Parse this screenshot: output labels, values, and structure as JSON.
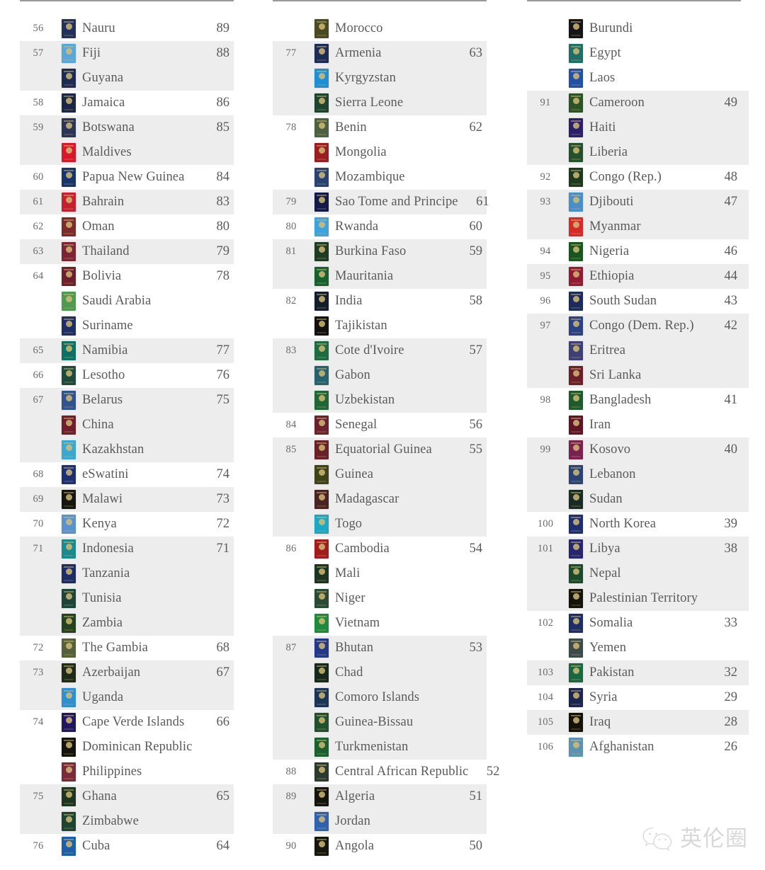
{
  "watermark": {
    "text": "英伦圈",
    "logo_icon": "wechat-logo-icon"
  },
  "columns": [
    {
      "id": "column-1",
      "rows": [
        {
          "rank": "56",
          "country": "Nauru",
          "score": "89",
          "shaded": false,
          "flag": "#22305a"
        },
        {
          "rank": "57",
          "country": "Fiji",
          "score": "88",
          "shaded": true,
          "flag": "#5aa7d8"
        },
        {
          "rank": "",
          "country": "Guyana",
          "score": "",
          "shaded": true,
          "flag": "#1d2a52"
        },
        {
          "rank": "58",
          "country": "Jamaica",
          "score": "86",
          "shaded": false,
          "flag": "#1b2545"
        },
        {
          "rank": "59",
          "country": "Botswana",
          "score": "85",
          "shaded": true,
          "flag": "#2c3554"
        },
        {
          "rank": "",
          "country": "Maldives",
          "score": "",
          "shaded": true,
          "flag": "#d8182a"
        },
        {
          "rank": "60",
          "country": "Papua New Guinea",
          "score": "84",
          "shaded": false,
          "flag": "#17356b"
        },
        {
          "rank": "61",
          "country": "Bahrain",
          "score": "83",
          "shaded": true,
          "flag": "#c42030"
        },
        {
          "rank": "62",
          "country": "Oman",
          "score": "80",
          "shaded": false,
          "flag": "#7c2b2b"
        },
        {
          "rank": "63",
          "country": "Thailand",
          "score": "79",
          "shaded": true,
          "flag": "#7d2435"
        },
        {
          "rank": "64",
          "country": "Bolivia",
          "score": "78",
          "shaded": false,
          "flag": "#6d1f2b"
        },
        {
          "rank": "",
          "country": "Saudi Arabia",
          "score": "",
          "shaded": false,
          "flag": "#4f9a52"
        },
        {
          "rank": "",
          "country": "Suriname",
          "score": "",
          "shaded": false,
          "flag": "#1d2f63"
        },
        {
          "rank": "65",
          "country": "Namibia",
          "score": "77",
          "shaded": true,
          "flag": "#0e6f63"
        },
        {
          "rank": "66",
          "country": "Lesotho",
          "score": "76",
          "shaded": false,
          "flag": "#1e4a3c"
        },
        {
          "rank": "67",
          "country": "Belarus",
          "score": "75",
          "shaded": true,
          "flag": "#2f538f"
        },
        {
          "rank": "",
          "country": "China",
          "score": "",
          "shaded": true,
          "flag": "#6f1f2c"
        },
        {
          "rank": "",
          "country": "Kazakhstan",
          "score": "",
          "shaded": true,
          "flag": "#3aa8d0"
        },
        {
          "rank": "68",
          "country": "eSwatini",
          "score": "74",
          "shaded": false,
          "flag": "#1c2f72"
        },
        {
          "rank": "69",
          "country": "Malawi",
          "score": "73",
          "shaded": true,
          "flag": "#171510"
        },
        {
          "rank": "70",
          "country": "Kenya",
          "score": "72",
          "shaded": false,
          "flag": "#5a92ce"
        },
        {
          "rank": "71",
          "country": "Indonesia",
          "score": "71",
          "shaded": true,
          "flag": "#1a8a8f"
        },
        {
          "rank": "",
          "country": "Tanzania",
          "score": "",
          "shaded": true,
          "flag": "#1e2c66"
        },
        {
          "rank": "",
          "country": "Tunisia",
          "score": "",
          "shaded": true,
          "flag": "#1d4438"
        },
        {
          "rank": "",
          "country": "Zambia",
          "score": "",
          "shaded": true,
          "flag": "#25421f"
        },
        {
          "rank": "72",
          "country": "The Gambia",
          "score": "68",
          "shaded": false,
          "flag": "#55603a"
        },
        {
          "rank": "73",
          "country": "Azerbaijan",
          "score": "67",
          "shaded": true,
          "flag": "#1f2b18"
        },
        {
          "rank": "",
          "country": "Uganda",
          "score": "",
          "shaded": true,
          "flag": "#2e8fd0"
        },
        {
          "rank": "74",
          "country": "Cape Verde Islands",
          "score": "66",
          "shaded": false,
          "flag": "#20175e"
        },
        {
          "rank": "",
          "country": "Dominican Republic",
          "score": "",
          "shaded": false,
          "flag": "#15130e"
        },
        {
          "rank": "",
          "country": "Philippines",
          "score": "",
          "shaded": false,
          "flag": "#7b2a3c"
        },
        {
          "rank": "75",
          "country": "Ghana",
          "score": "65",
          "shaded": true,
          "flag": "#1f3520"
        },
        {
          "rank": "",
          "country": "Zimbabwe",
          "score": "",
          "shaded": true,
          "flag": "#1c4430"
        },
        {
          "rank": "76",
          "country": "Cuba",
          "score": "64",
          "shaded": false,
          "flag": "#1c5fa8"
        }
      ]
    },
    {
      "id": "column-2",
      "rows": [
        {
          "rank": "",
          "country": "Morocco",
          "score": "",
          "shaded": false,
          "flag": "#4a4a22"
        },
        {
          "rank": "77",
          "country": "Armenia",
          "score": "63",
          "shaded": true,
          "flag": "#1d2c57"
        },
        {
          "rank": "",
          "country": "Kyrgyzstan",
          "score": "",
          "shaded": true,
          "flag": "#1f8fd4"
        },
        {
          "rank": "",
          "country": "Sierra Leone",
          "score": "",
          "shaded": true,
          "flag": "#1d4331"
        },
        {
          "rank": "78",
          "country": "Benin",
          "score": "62",
          "shaded": false,
          "flag": "#4d6041"
        },
        {
          "rank": "",
          "country": "Mongolia",
          "score": "",
          "shaded": false,
          "flag": "#9b1d22"
        },
        {
          "rank": "",
          "country": "Mozambique",
          "score": "",
          "shaded": false,
          "flag": "#2a4272"
        },
        {
          "rank": "79",
          "country": "Sao Tome and Principe",
          "score": "61",
          "shaded": true,
          "flag": "#131a4a"
        },
        {
          "rank": "80",
          "country": "Rwanda",
          "score": "60",
          "shaded": false,
          "flag": "#3ca3dc"
        },
        {
          "rank": "81",
          "country": "Burkina Faso",
          "score": "59",
          "shaded": true,
          "flag": "#1e3b24"
        },
        {
          "rank": "",
          "country": "Mauritania",
          "score": "",
          "shaded": true,
          "flag": "#16622f"
        },
        {
          "rank": "82",
          "country": "India",
          "score": "58",
          "shaded": false,
          "flag": "#131c2c"
        },
        {
          "rank": "",
          "country": "Tajikistan",
          "score": "",
          "shaded": false,
          "flag": "#121110"
        },
        {
          "rank": "83",
          "country": "Cote d'Ivoire",
          "score": "57",
          "shaded": true,
          "flag": "#1c6b42"
        },
        {
          "rank": "",
          "country": "Gabon",
          "score": "",
          "shaded": true,
          "flag": "#26626e"
        },
        {
          "rank": "",
          "country": "Uzbekistan",
          "score": "",
          "shaded": true,
          "flag": "#1e6638"
        },
        {
          "rank": "84",
          "country": "Senegal",
          "score": "56",
          "shaded": false,
          "flag": "#6b2230"
        },
        {
          "rank": "85",
          "country": "Equatorial Guinea",
          "score": "55",
          "shaded": true,
          "flag": "#6a2029"
        },
        {
          "rank": "",
          "country": "Guinea",
          "score": "",
          "shaded": true,
          "flag": "#3f4118"
        },
        {
          "rank": "",
          "country": "Madagascar",
          "score": "",
          "shaded": true,
          "flag": "#4a2223"
        },
        {
          "rank": "",
          "country": "Togo",
          "score": "",
          "shaded": true,
          "flag": "#1aa8c4"
        },
        {
          "rank": "86",
          "country": "Cambodia",
          "score": "54",
          "shaded": false,
          "flag": "#a31b1b"
        },
        {
          "rank": "",
          "country": "Mali",
          "score": "",
          "shaded": false,
          "flag": "#1c3520"
        },
        {
          "rank": "",
          "country": "Niger",
          "score": "",
          "shaded": false,
          "flag": "#2b4a35"
        },
        {
          "rank": "",
          "country": "Vietnam",
          "score": "",
          "shaded": false,
          "flag": "#1f8a3e"
        },
        {
          "rank": "87",
          "country": "Bhutan",
          "score": "53",
          "shaded": true,
          "flag": "#23388c"
        },
        {
          "rank": "",
          "country": "Chad",
          "score": "",
          "shaded": true,
          "flag": "#14291a"
        },
        {
          "rank": "",
          "country": "Comoro Islands",
          "score": "",
          "shaded": true,
          "flag": "#1b3558"
        },
        {
          "rank": "",
          "country": "Guinea-Bissau",
          "score": "",
          "shaded": true,
          "flag": "#20502d"
        },
        {
          "rank": "",
          "country": "Turkmenistan",
          "score": "",
          "shaded": true,
          "flag": "#19622e"
        },
        {
          "rank": "88",
          "country": "Central African Republic",
          "score": "52",
          "shaded": false,
          "flag": "#2b3a30"
        },
        {
          "rank": "89",
          "country": "Algeria",
          "score": "51",
          "shaded": true,
          "flag": "#14130e"
        },
        {
          "rank": "",
          "country": "Jordan",
          "score": "",
          "shaded": true,
          "flag": "#2f62ae"
        },
        {
          "rank": "90",
          "country": "Angola",
          "score": "50",
          "shaded": false,
          "flag": "#15170f"
        }
      ]
    },
    {
      "id": "column-3",
      "rows": [
        {
          "rank": "",
          "country": "Burundi",
          "score": "",
          "shaded": false,
          "flag": "#151418"
        },
        {
          "rank": "",
          "country": "Egypt",
          "score": "",
          "shaded": false,
          "flag": "#1f6f66"
        },
        {
          "rank": "",
          "country": "Laos",
          "score": "",
          "shaded": false,
          "flag": "#2351a5"
        },
        {
          "rank": "91",
          "country": "Cameroon",
          "score": "49",
          "shaded": true,
          "flag": "#2c5227"
        },
        {
          "rank": "",
          "country": "Haiti",
          "score": "",
          "shaded": true,
          "flag": "#2a1f68"
        },
        {
          "rank": "",
          "country": "Liberia",
          "score": "",
          "shaded": true,
          "flag": "#25502e"
        },
        {
          "rank": "92",
          "country": "Congo (Rep.)",
          "score": "48",
          "shaded": false,
          "flag": "#1d3a1f"
        },
        {
          "rank": "93",
          "country": "Djibouti",
          "score": "47",
          "shaded": true,
          "flag": "#4a8ec8"
        },
        {
          "rank": "",
          "country": "Myanmar",
          "score": "",
          "shaded": true,
          "flag": "#d42a2a"
        },
        {
          "rank": "94",
          "country": "Nigeria",
          "score": "46",
          "shaded": false,
          "flag": "#18551f"
        },
        {
          "rank": "95",
          "country": "Ethiopia",
          "score": "44",
          "shaded": true,
          "flag": "#901b33"
        },
        {
          "rank": "96",
          "country": "South Sudan",
          "score": "43",
          "shaded": false,
          "flag": "#1b2b5e"
        },
        {
          "rank": "97",
          "country": "Congo (Dem. Rep.)",
          "score": "42",
          "shaded": true,
          "flag": "#2b4183"
        },
        {
          "rank": "",
          "country": "Eritrea",
          "score": "",
          "shaded": true,
          "flag": "#3d3f75"
        },
        {
          "rank": "",
          "country": "Sri Lanka",
          "score": "",
          "shaded": true,
          "flag": "#6a2029"
        },
        {
          "rank": "98",
          "country": "Bangladesh",
          "score": "41",
          "shaded": false,
          "flag": "#1f5a2c"
        },
        {
          "rank": "",
          "country": "Iran",
          "score": "",
          "shaded": false,
          "flag": "#5e1626"
        },
        {
          "rank": "99",
          "country": "Kosovo",
          "score": "40",
          "shaded": true,
          "flag": "#7b2150"
        },
        {
          "rank": "",
          "country": "Lebanon",
          "score": "",
          "shaded": true,
          "flag": "#2b4372"
        },
        {
          "rank": "",
          "country": "Sudan",
          "score": "",
          "shaded": true,
          "flag": "#1a2a24"
        },
        {
          "rank": "100",
          "country": "North Korea",
          "score": "39",
          "shaded": false,
          "flag": "#1d2f70"
        },
        {
          "rank": "101",
          "country": "Libya",
          "score": "38",
          "shaded": true,
          "flag": "#26266e"
        },
        {
          "rank": "",
          "country": "Nepal",
          "score": "",
          "shaded": true,
          "flag": "#1a4a2a"
        },
        {
          "rank": "",
          "country": "Palestinian Territory",
          "score": "",
          "shaded": true,
          "flag": "#141209"
        },
        {
          "rank": "102",
          "country": "Somalia",
          "score": "33",
          "shaded": false,
          "flag": "#1e2d63"
        },
        {
          "rank": "",
          "country": "Yemen",
          "score": "",
          "shaded": false,
          "flag": "#3d4a4a"
        },
        {
          "rank": "103",
          "country": "Pakistan",
          "score": "32",
          "shaded": true,
          "flag": "#1a6640"
        },
        {
          "rank": "104",
          "country": "Syria",
          "score": "29",
          "shaded": false,
          "flag": "#1c2550"
        },
        {
          "rank": "105",
          "country": "Iraq",
          "score": "28",
          "shaded": true,
          "flag": "#141109"
        },
        {
          "rank": "106",
          "country": "Afghanistan",
          "score": "26",
          "shaded": false,
          "flag": "#5c91b0"
        }
      ]
    }
  ]
}
